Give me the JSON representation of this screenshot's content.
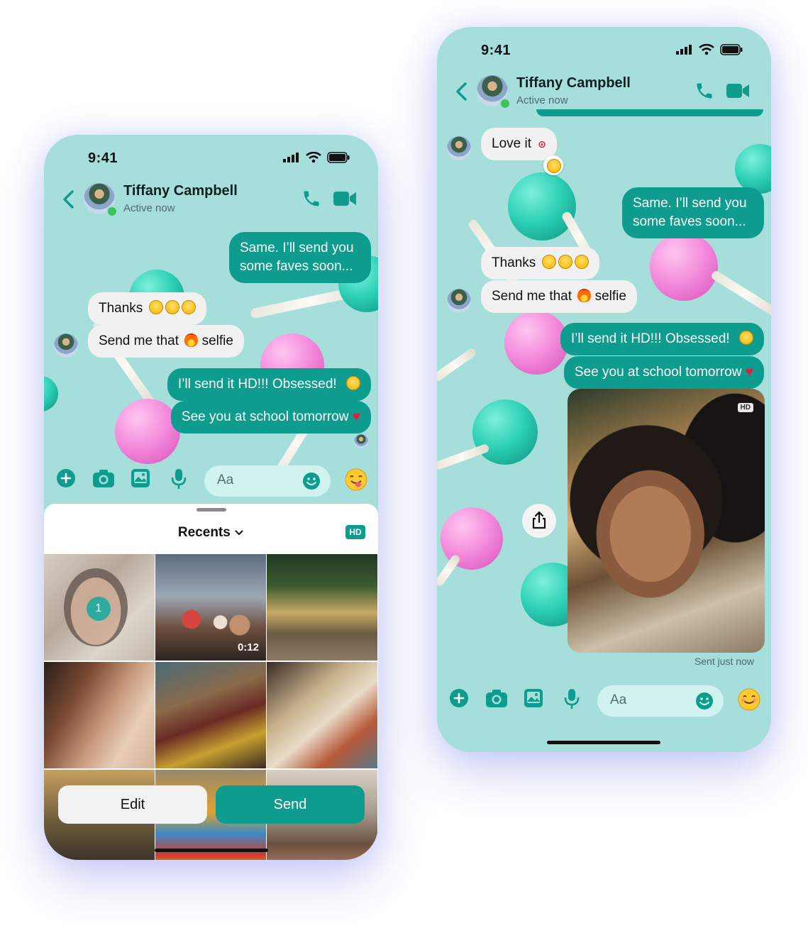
{
  "status": {
    "time": "9:41"
  },
  "contact": {
    "name": "Tiffany Campbell",
    "status": "Active now"
  },
  "composer": {
    "placeholder": "Aa"
  },
  "left": {
    "messages": {
      "m1": "Same. I’ll send you",
      "m1b": "some faves soon...",
      "m2": "Thanks",
      "m3a": "Send me that",
      "m3b": "selfie",
      "m4": "I’ll send it HD!!! Obsessed!",
      "m5": "See you at school tomorrow"
    },
    "sheet": {
      "title": "Recents",
      "hd_label": "HD",
      "selected_index": "1",
      "video_duration": "0:12",
      "edit_label": "Edit",
      "send_label": "Send"
    }
  },
  "right": {
    "messages": {
      "m0": "Love it",
      "m1": "Same. I’ll send you",
      "m1b": "some faves soon...",
      "m2": "Thanks",
      "m3a": "Send me that",
      "m3b": "selfie",
      "m4": "I’ll send it HD!!! Obsessed!",
      "m5": "See you at school tomorrow"
    },
    "photo_hd": "HD",
    "sent_status": "Sent just now"
  },
  "colors": {
    "accent": "#0e9c8e",
    "background": "#a6dedb",
    "incoming": "#f1f1f1"
  }
}
